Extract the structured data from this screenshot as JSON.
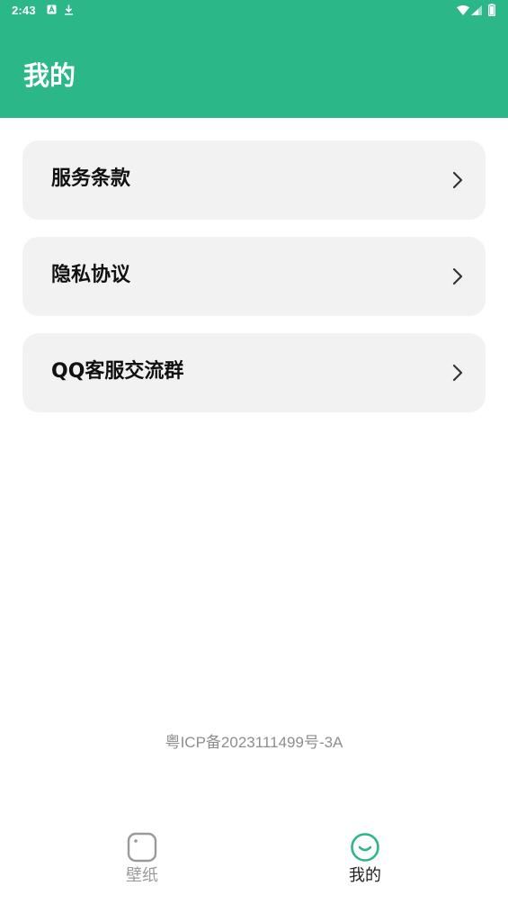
{
  "status_bar": {
    "time": "2:43",
    "icons": [
      "notification-a-icon",
      "download-icon",
      "wifi-icon",
      "cell-signal-icon",
      "battery-icon"
    ]
  },
  "header": {
    "title": "我的"
  },
  "menu": {
    "items": [
      {
        "label": "服务条款",
        "icon": "chevron-right-icon"
      },
      {
        "label": "隐私协议",
        "icon": "chevron-right-icon"
      },
      {
        "label": "QQ客服交流群",
        "icon": "chevron-right-icon"
      }
    ]
  },
  "footer": {
    "icp": "粤ICP备2023111499号-3A"
  },
  "bottom_nav": {
    "tabs": [
      {
        "label": "壁纸",
        "icon": "wallpaper-icon",
        "active": false
      },
      {
        "label": "我的",
        "icon": "smile-face-icon",
        "active": true
      }
    ]
  },
  "colors": {
    "primary": "#2bb788",
    "card_background": "#f2f2f2",
    "inactive": "#9a9a9a",
    "footer_text": "#8e8e8e"
  }
}
